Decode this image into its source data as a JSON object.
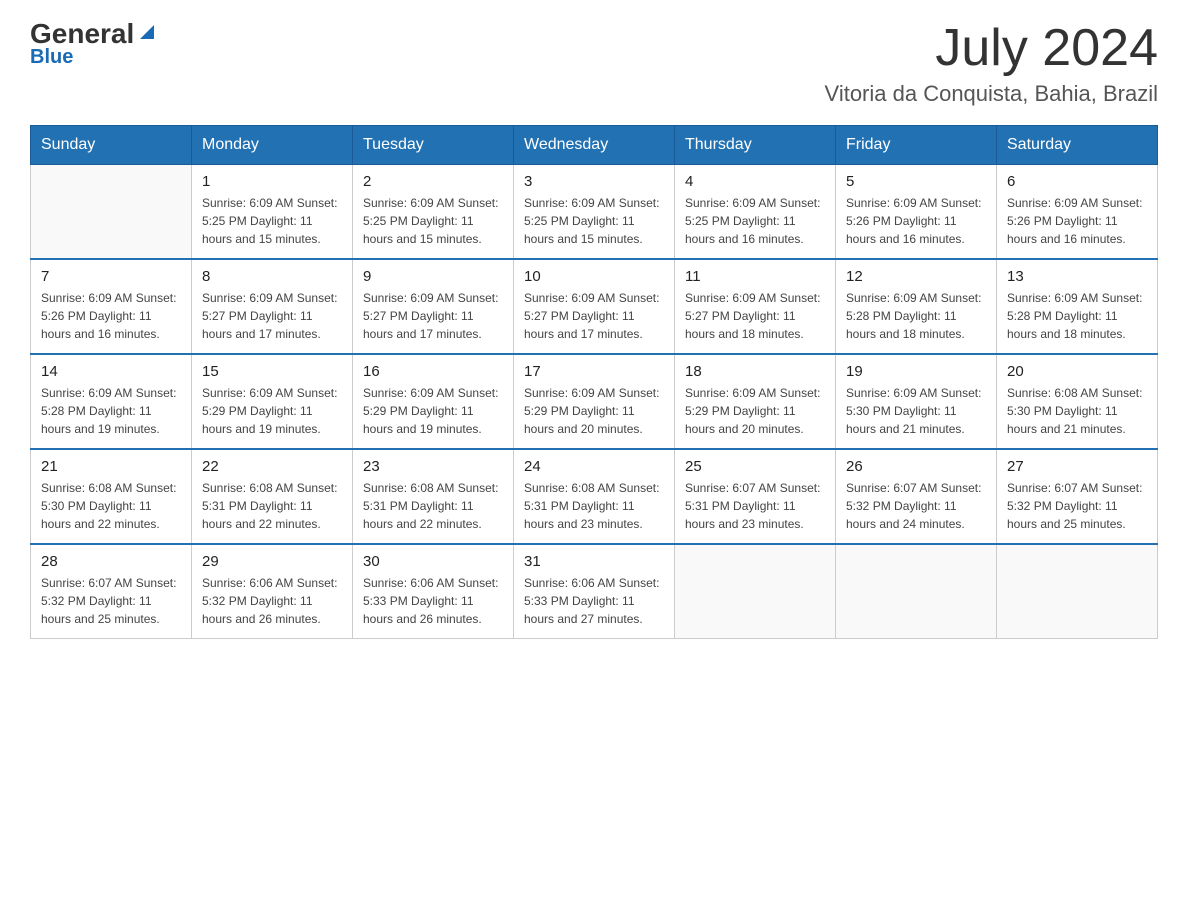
{
  "logo": {
    "general": "General",
    "blue": "Blue",
    "triangle_symbol": "▲"
  },
  "title": {
    "month_year": "July 2024",
    "location": "Vitoria da Conquista, Bahia, Brazil"
  },
  "headers": [
    "Sunday",
    "Monday",
    "Tuesday",
    "Wednesday",
    "Thursday",
    "Friday",
    "Saturday"
  ],
  "weeks": [
    [
      {
        "day": "",
        "info": ""
      },
      {
        "day": "1",
        "info": "Sunrise: 6:09 AM\nSunset: 5:25 PM\nDaylight: 11 hours\nand 15 minutes."
      },
      {
        "day": "2",
        "info": "Sunrise: 6:09 AM\nSunset: 5:25 PM\nDaylight: 11 hours\nand 15 minutes."
      },
      {
        "day": "3",
        "info": "Sunrise: 6:09 AM\nSunset: 5:25 PM\nDaylight: 11 hours\nand 15 minutes."
      },
      {
        "day": "4",
        "info": "Sunrise: 6:09 AM\nSunset: 5:25 PM\nDaylight: 11 hours\nand 16 minutes."
      },
      {
        "day": "5",
        "info": "Sunrise: 6:09 AM\nSunset: 5:26 PM\nDaylight: 11 hours\nand 16 minutes."
      },
      {
        "day": "6",
        "info": "Sunrise: 6:09 AM\nSunset: 5:26 PM\nDaylight: 11 hours\nand 16 minutes."
      }
    ],
    [
      {
        "day": "7",
        "info": "Sunrise: 6:09 AM\nSunset: 5:26 PM\nDaylight: 11 hours\nand 16 minutes."
      },
      {
        "day": "8",
        "info": "Sunrise: 6:09 AM\nSunset: 5:27 PM\nDaylight: 11 hours\nand 17 minutes."
      },
      {
        "day": "9",
        "info": "Sunrise: 6:09 AM\nSunset: 5:27 PM\nDaylight: 11 hours\nand 17 minutes."
      },
      {
        "day": "10",
        "info": "Sunrise: 6:09 AM\nSunset: 5:27 PM\nDaylight: 11 hours\nand 17 minutes."
      },
      {
        "day": "11",
        "info": "Sunrise: 6:09 AM\nSunset: 5:27 PM\nDaylight: 11 hours\nand 18 minutes."
      },
      {
        "day": "12",
        "info": "Sunrise: 6:09 AM\nSunset: 5:28 PM\nDaylight: 11 hours\nand 18 minutes."
      },
      {
        "day": "13",
        "info": "Sunrise: 6:09 AM\nSunset: 5:28 PM\nDaylight: 11 hours\nand 18 minutes."
      }
    ],
    [
      {
        "day": "14",
        "info": "Sunrise: 6:09 AM\nSunset: 5:28 PM\nDaylight: 11 hours\nand 19 minutes."
      },
      {
        "day": "15",
        "info": "Sunrise: 6:09 AM\nSunset: 5:29 PM\nDaylight: 11 hours\nand 19 minutes."
      },
      {
        "day": "16",
        "info": "Sunrise: 6:09 AM\nSunset: 5:29 PM\nDaylight: 11 hours\nand 19 minutes."
      },
      {
        "day": "17",
        "info": "Sunrise: 6:09 AM\nSunset: 5:29 PM\nDaylight: 11 hours\nand 20 minutes."
      },
      {
        "day": "18",
        "info": "Sunrise: 6:09 AM\nSunset: 5:29 PM\nDaylight: 11 hours\nand 20 minutes."
      },
      {
        "day": "19",
        "info": "Sunrise: 6:09 AM\nSunset: 5:30 PM\nDaylight: 11 hours\nand 21 minutes."
      },
      {
        "day": "20",
        "info": "Sunrise: 6:08 AM\nSunset: 5:30 PM\nDaylight: 11 hours\nand 21 minutes."
      }
    ],
    [
      {
        "day": "21",
        "info": "Sunrise: 6:08 AM\nSunset: 5:30 PM\nDaylight: 11 hours\nand 22 minutes."
      },
      {
        "day": "22",
        "info": "Sunrise: 6:08 AM\nSunset: 5:31 PM\nDaylight: 11 hours\nand 22 minutes."
      },
      {
        "day": "23",
        "info": "Sunrise: 6:08 AM\nSunset: 5:31 PM\nDaylight: 11 hours\nand 22 minutes."
      },
      {
        "day": "24",
        "info": "Sunrise: 6:08 AM\nSunset: 5:31 PM\nDaylight: 11 hours\nand 23 minutes."
      },
      {
        "day": "25",
        "info": "Sunrise: 6:07 AM\nSunset: 5:31 PM\nDaylight: 11 hours\nand 23 minutes."
      },
      {
        "day": "26",
        "info": "Sunrise: 6:07 AM\nSunset: 5:32 PM\nDaylight: 11 hours\nand 24 minutes."
      },
      {
        "day": "27",
        "info": "Sunrise: 6:07 AM\nSunset: 5:32 PM\nDaylight: 11 hours\nand 25 minutes."
      }
    ],
    [
      {
        "day": "28",
        "info": "Sunrise: 6:07 AM\nSunset: 5:32 PM\nDaylight: 11 hours\nand 25 minutes."
      },
      {
        "day": "29",
        "info": "Sunrise: 6:06 AM\nSunset: 5:32 PM\nDaylight: 11 hours\nand 26 minutes."
      },
      {
        "day": "30",
        "info": "Sunrise: 6:06 AM\nSunset: 5:33 PM\nDaylight: 11 hours\nand 26 minutes."
      },
      {
        "day": "31",
        "info": "Sunrise: 6:06 AM\nSunset: 5:33 PM\nDaylight: 11 hours\nand 27 minutes."
      },
      {
        "day": "",
        "info": ""
      },
      {
        "day": "",
        "info": ""
      },
      {
        "day": "",
        "info": ""
      }
    ]
  ]
}
